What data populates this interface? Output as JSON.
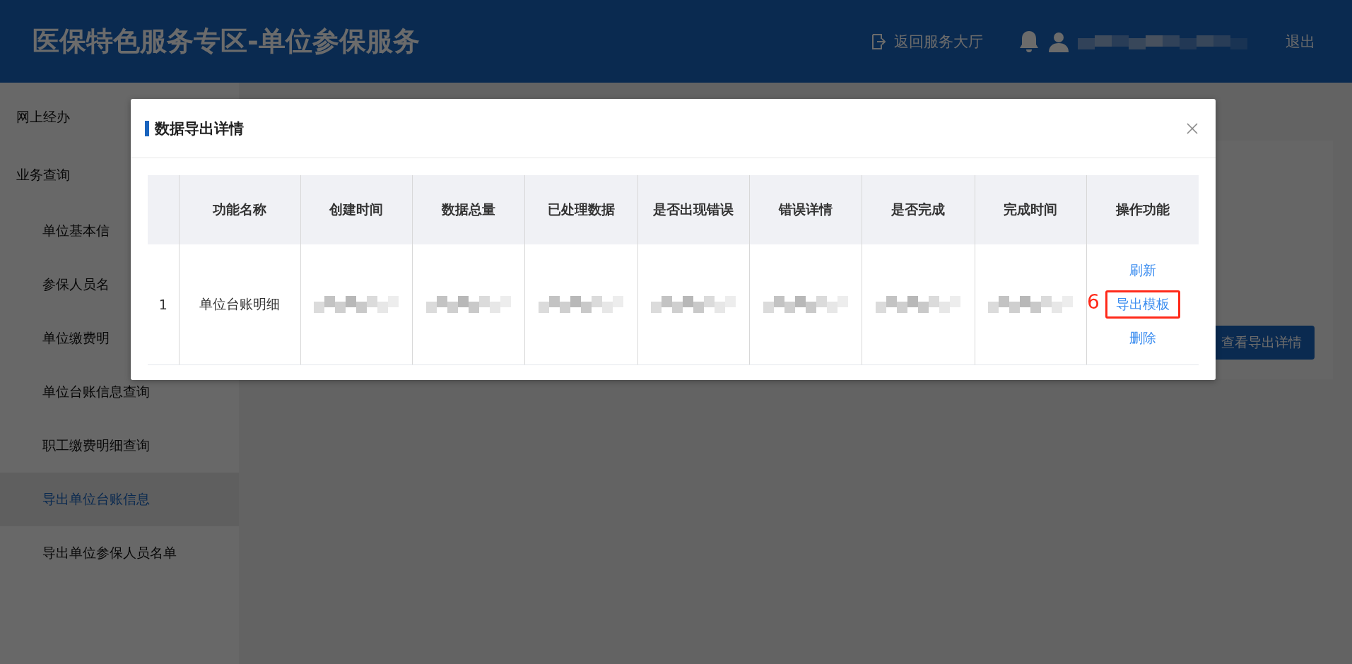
{
  "header": {
    "title": "医保特色服务专区-单位参保服务",
    "back_link": "返回服务大厅",
    "user_name": {
      "kind": "redacted"
    },
    "logout": "退出"
  },
  "sidebar": {
    "items": [
      {
        "label": "网上经办",
        "selected": false
      },
      {
        "label": "业务查询",
        "selected": false,
        "children": [
          {
            "label": "单位基本信",
            "selected": false
          },
          {
            "label": "参保人员名",
            "selected": false
          },
          {
            "label": "单位缴费明",
            "selected": false
          },
          {
            "label": "单位台账信息查询",
            "selected": false
          },
          {
            "label": "职工缴费明细查询",
            "selected": false
          },
          {
            "label": "导出单位台账信息",
            "selected": true
          },
          {
            "label": "导出单位参保人员名单",
            "selected": false
          }
        ]
      }
    ]
  },
  "content": {
    "button": "查看导出详情"
  },
  "dialog": {
    "title": "数据导出详情",
    "table": {
      "columns": [
        "",
        "功能名称",
        "创建时间",
        "数据总量",
        "已处理数据",
        "是否出现错误",
        "错误详情",
        "是否完成",
        "完成时间",
        "操作功能"
      ],
      "rows": [
        {
          "cells": [
            {
              "kind": "text",
              "text": "1"
            },
            {
              "kind": "text",
              "text": "单位台账明细"
            },
            {
              "kind": "redacted"
            },
            {
              "kind": "redacted"
            },
            {
              "kind": "redacted"
            },
            {
              "kind": "redacted"
            },
            {
              "kind": "redacted"
            },
            {
              "kind": "redacted"
            },
            {
              "kind": "redacted"
            },
            {
              "kind": "actions",
              "actions": [
                {
                  "label": "刷新",
                  "highlighted": false
                },
                {
                  "label": "导出模板",
                  "highlighted": true,
                  "marker": "6"
                },
                {
                  "label": "删除",
                  "highlighted": false
                }
              ]
            }
          ]
        }
      ]
    }
  }
}
